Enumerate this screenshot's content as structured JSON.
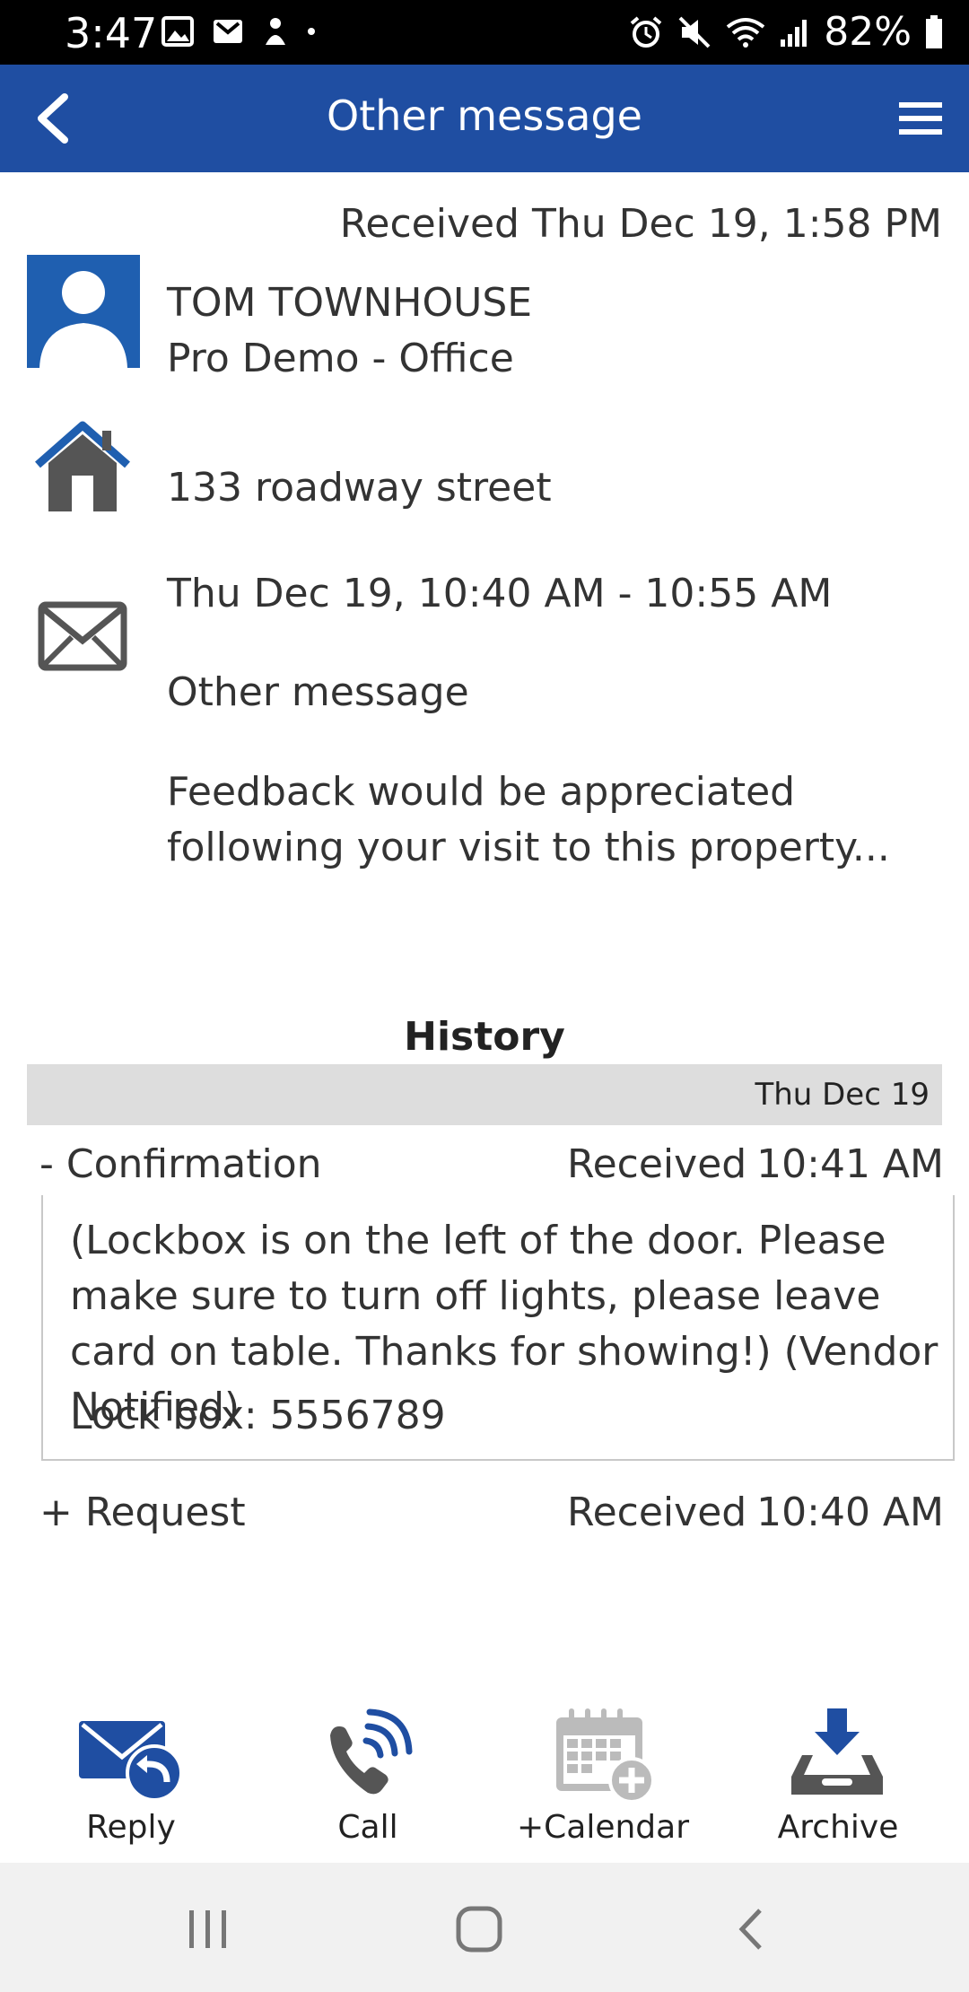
{
  "status_bar": {
    "time": "3:47",
    "battery": "82%",
    "left_icons": [
      "image-icon",
      "gmail-icon",
      "person-icon",
      "dot-icon"
    ],
    "right_icons": [
      "alarm-icon",
      "mute-icon",
      "wifi-icon",
      "signal-icon",
      "battery-icon"
    ]
  },
  "app_bar": {
    "title": "Other message",
    "back_icon": "chevron-left-icon",
    "menu_icon": "hamburger-menu-icon"
  },
  "message": {
    "received": "Received Thu Dec 19, 1:58 PM",
    "contact_name": "TOM TOWNHOUSE",
    "contact_office": "Pro Demo - Office",
    "address": "133 roadway street",
    "appointment_time": "Thu Dec 19, 10:40 AM - 10:55 AM",
    "type": "Other message",
    "body": "Feedback would be appreciated following your visit to this property..."
  },
  "history": {
    "heading": "History",
    "date": "Thu Dec 19",
    "entries": [
      {
        "label": "- Confirmation",
        "status": "Received",
        "time": "10:41 AM",
        "detail": "(Lockbox is on the left of the door. Please make sure to turn off lights, please leave card on table. Thanks for showing!) (Vendor Notified)",
        "lockbox": "Lock box: 5556789"
      },
      {
        "label": "+ Request",
        "status": "Received",
        "time": "10:40 AM"
      }
    ]
  },
  "actions": [
    {
      "label": "Reply",
      "icon": "reply-mail-icon"
    },
    {
      "label": "Call",
      "icon": "phone-call-icon"
    },
    {
      "label": "+Calendar",
      "icon": "add-calendar-icon"
    },
    {
      "label": "Archive",
      "icon": "archive-tray-icon"
    }
  ],
  "colors": {
    "brand_blue": "#1f4ea2",
    "icon_gray": "#555555",
    "history_bar": "#dddddd"
  }
}
